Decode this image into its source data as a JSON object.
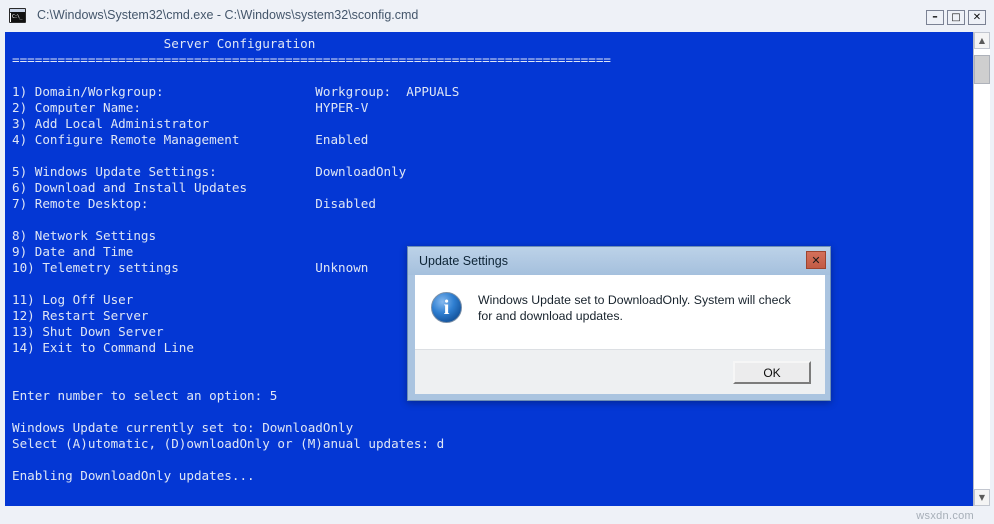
{
  "window": {
    "title": "C:\\Windows\\System32\\cmd.exe - C:\\Windows\\system32\\sconfig.cmd",
    "icon": "cmd-console-icon",
    "controls": {
      "minimize": "–",
      "maximize": "□",
      "close": "✕"
    },
    "scrollbar": {
      "up_arrow": "▲",
      "down_arrow": "▼"
    },
    "background_color": "#0437d4",
    "text_color": "#dfe6f5"
  },
  "console": {
    "heading": "                    Server Configuration",
    "separator": "===============================================================================",
    "lines": [
      "",
      "1) Domain/Workgroup:                    Workgroup:  APPUALS",
      "2) Computer Name:                       HYPER-V",
      "3) Add Local Administrator",
      "4) Configure Remote Management          Enabled",
      "",
      "5) Windows Update Settings:             DownloadOnly",
      "6) Download and Install Updates",
      "7) Remote Desktop:                      Disabled",
      "",
      "8) Network Settings",
      "9) Date and Time",
      "10) Telemetry settings                  Unknown",
      "",
      "11) Log Off User",
      "12) Restart Server",
      "13) Shut Down Server",
      "14) Exit to Command Line",
      "",
      "",
      "Enter number to select an option: 5",
      "",
      "Windows Update currently set to: DownloadOnly",
      "Select (A)utomatic, (D)ownloadOnly or (M)anual updates: d",
      "",
      "Enabling DownloadOnly updates..."
    ]
  },
  "dialog": {
    "title": "Update Settings",
    "close_label": "✕",
    "icon": "information-icon",
    "message": "Windows Update set to DownloadOnly.  System will check for and download updates.",
    "ok_label": "OK",
    "title_color": "#aac4e0",
    "close_color": "#c25b45"
  },
  "watermark": {
    "text": "wsxdn.com"
  }
}
